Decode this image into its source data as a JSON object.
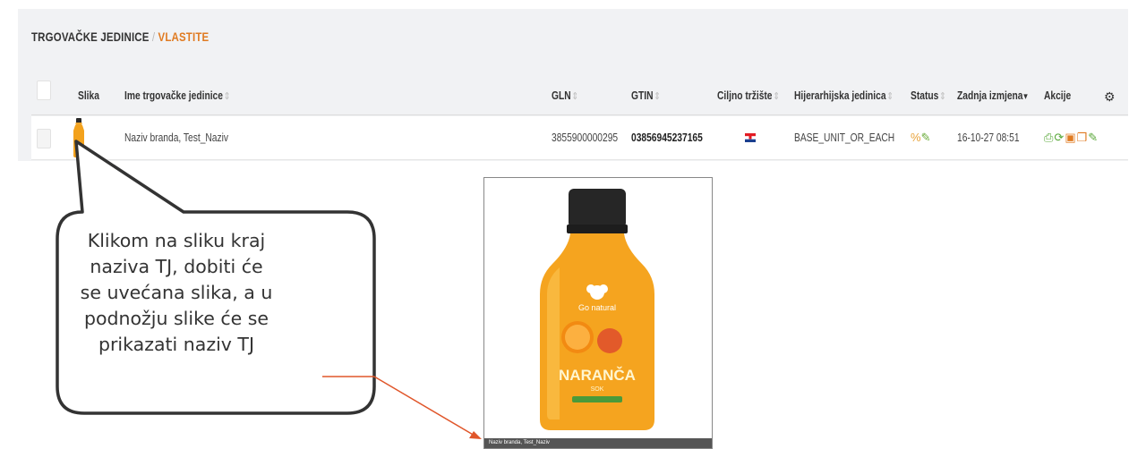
{
  "breadcrumb": {
    "first": "TRGOVAČKE JEDINICE",
    "sep": "/",
    "last": "VLASTITE"
  },
  "table": {
    "headers": {
      "image": "Slika",
      "name": "Ime trgovačke jedinice",
      "gln": "GLN",
      "gtin": "GTIN",
      "target_market": "Ciljno tržište",
      "hierarchy": "Hijerarhijska jedinica",
      "status": "Status",
      "last_change": "Zadnja izmjena",
      "actions": "Akcije"
    },
    "sort_glyph": "⇕",
    "sort_desc_glyph": "▾",
    "rows": [
      {
        "name": "Naziv branda, Test_Naziv",
        "gln": "3855900000295",
        "gtin": "03856945237165",
        "hierarchy": "BASE_UNIT_OR_EACH",
        "last_change": "16-10-27 08:51"
      }
    ]
  },
  "preview": {
    "caption": "Naziv branda, Test_Naziv",
    "bottle_brand": "Go natural",
    "bottle_label": "NARANČA",
    "bottle_sub": "SOK"
  },
  "callout": {
    "lines": [
      "Klikom na sliku kraj",
      "naziva TJ, dobiti će",
      "se uvećana slika, a u",
      "podnožju slike će se",
      "prikazati naziv TJ"
    ]
  },
  "colors": {
    "accent": "#e07b22",
    "arrow": "#e0562a"
  }
}
